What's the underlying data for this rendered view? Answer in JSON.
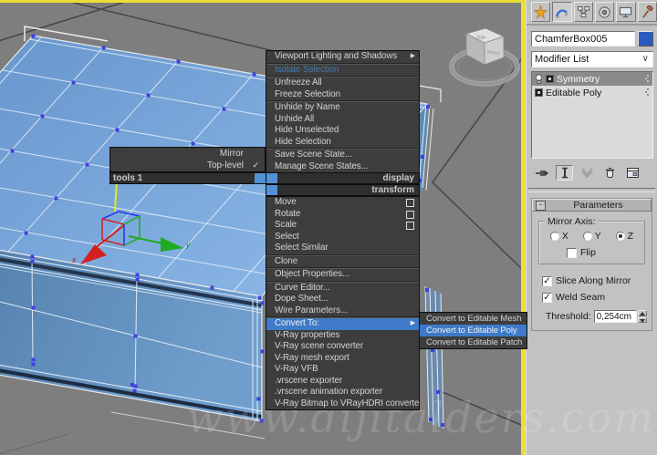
{
  "viewport": {
    "watermark": "www.dijitalders.com",
    "gizmo": {
      "x_label": "x",
      "y_label": "y"
    },
    "viewcube": {
      "top": "TOP",
      "right": "RIGHT"
    }
  },
  "quad_menu": {
    "tools1": {
      "title": "tools 1",
      "items": [
        {
          "label": "Mirror",
          "checked": false
        },
        {
          "label": "Top-level",
          "checked": true
        }
      ],
      "check_glyph": "✓"
    },
    "display": {
      "title": "display",
      "items": [
        {
          "label": "Viewport Lighting and Shadows",
          "arrow": true,
          "sep_after": true
        },
        {
          "label": "Isolate Selection",
          "accent": true,
          "sep_after": true
        },
        {
          "label": "Unfreeze All"
        },
        {
          "label": "Freeze Selection",
          "sep_after": true
        },
        {
          "label": "Unhide by Name"
        },
        {
          "label": "Unhide All"
        },
        {
          "label": "Hide Unselected"
        },
        {
          "label": "Hide Selection",
          "sep_after": true
        },
        {
          "label": "Save Scene State..."
        },
        {
          "label": "Manage Scene States..."
        }
      ]
    },
    "transform": {
      "title": "transform",
      "items": [
        {
          "label": "Move",
          "settings_box": true
        },
        {
          "label": "Rotate",
          "settings_box": true
        },
        {
          "label": "Scale",
          "settings_box": true
        },
        {
          "label": "Select"
        },
        {
          "label": "Select Similar",
          "sep_after": true
        },
        {
          "label": "Clone",
          "sep_after": true
        },
        {
          "label": "Object Properties...",
          "sep_after": true
        },
        {
          "label": "Curve Editor..."
        },
        {
          "label": "Dope Sheet..."
        },
        {
          "label": "Wire Parameters...",
          "sep_after": true
        },
        {
          "label": "Convert To:",
          "arrow": true,
          "highlighted": true
        },
        {
          "label": "V-Ray properties"
        },
        {
          "label": "V-Ray scene converter"
        },
        {
          "label": "V-Ray mesh export"
        },
        {
          "label": "V-Ray VFB"
        },
        {
          "label": ".vrscene exporter"
        },
        {
          "label": ".vrscene animation exporter"
        },
        {
          "label": "V-Ray Bitmap to VRayHDRI converter"
        }
      ]
    },
    "convert_submenu": {
      "items": [
        {
          "label": "Convert to Editable Mesh"
        },
        {
          "label": "Convert to Editable Poly",
          "highlighted": true
        },
        {
          "label": "Convert to Editable Patch"
        }
      ]
    }
  },
  "command_panel": {
    "tabs": [
      {
        "name": "create"
      },
      {
        "name": "modify",
        "active": true
      },
      {
        "name": "hierarchy"
      },
      {
        "name": "motion"
      },
      {
        "name": "display"
      },
      {
        "name": "utilities"
      }
    ],
    "object_name": "ChamferBox005",
    "modifier_list_label": "Modifier List",
    "modifier_stack": [
      {
        "label": "Symmetry",
        "selected": true,
        "bulb": true
      },
      {
        "label": "Editable Poly"
      }
    ],
    "parameters": {
      "rollout_title": "Parameters",
      "collapse_glyph": "-",
      "mirror_axis": {
        "group_label": "Mirror Axis:",
        "options": [
          {
            "label": "X",
            "selected": false
          },
          {
            "label": "Y",
            "selected": false
          },
          {
            "label": "Z",
            "selected": true
          }
        ],
        "flip": {
          "label": "Flip",
          "checked": false
        }
      },
      "checkboxes": [
        {
          "label": "Slice Along Mirror",
          "checked": true
        },
        {
          "label": "Weld Seam",
          "checked": true
        }
      ],
      "threshold": {
        "label": "Threshold:",
        "value": "0,254cm"
      },
      "check_glyph": "✓"
    }
  },
  "colors": {
    "highlight_blue": "#3f7ac8",
    "quad_blue_square": "#5391d6",
    "viewport_border_yellow": "#e9df38",
    "object_top_blue": "#86b4e4",
    "object_front_blue": "#4a759f",
    "vertex_blue": "#4040e0",
    "name_swatch_blue": "#2a5bc0"
  }
}
